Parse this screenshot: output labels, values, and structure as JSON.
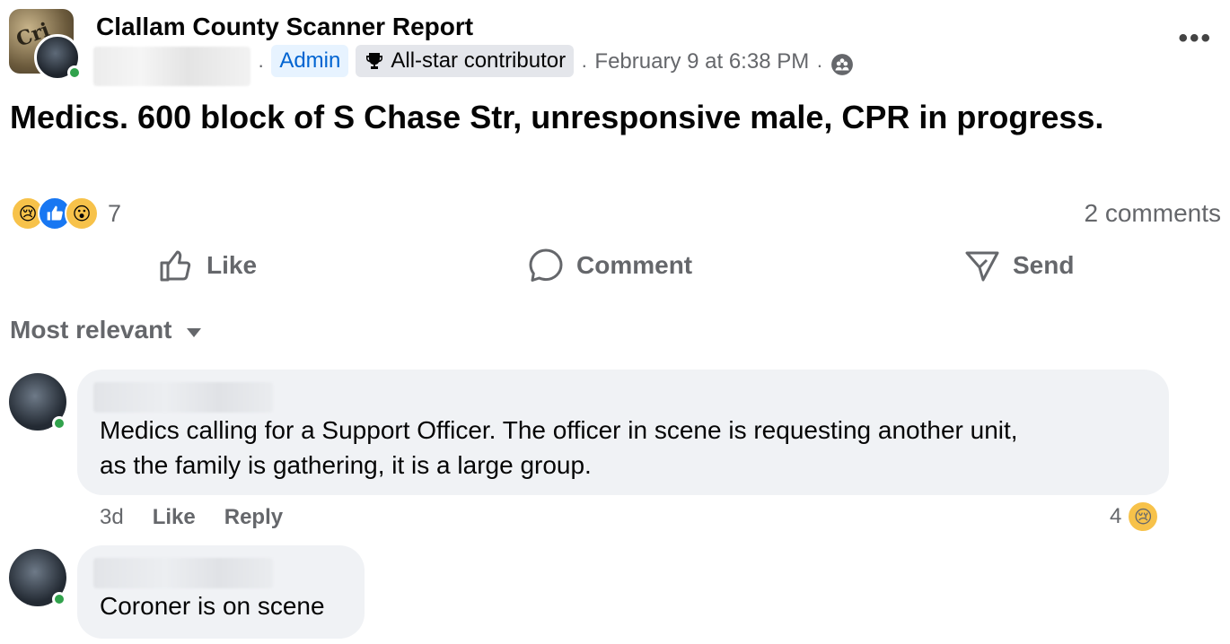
{
  "post": {
    "group_name": "Clallam County Scanner Report",
    "group_avatar_text": "Cri",
    "admin_badge": "Admin",
    "allstar_badge": "All-star contributor",
    "timestamp": "February 9 at 6:38 PM",
    "body": "Medics. 600 block of S Chase Str, unresponsive male, CPR in progress."
  },
  "reactions": {
    "count": "7",
    "comments_count": "2 comments"
  },
  "actions": {
    "like": "Like",
    "comment": "Comment",
    "send": "Send"
  },
  "sort": {
    "label": "Most relevant"
  },
  "comments": [
    {
      "text_line1": "Medics calling for a Support Officer. The officer in scene is requesting another unit,",
      "text_line2": "as the family is gathering, it is a large group.",
      "age": "3d",
      "like": "Like",
      "reply": "Reply",
      "reaction_count": "4"
    },
    {
      "text_line1": "Coroner is on scene"
    }
  ],
  "colors": {
    "admin_badge_bg": "#e7f3ff",
    "admin_text": "#0064d1",
    "online": "#31a24c",
    "bubble_bg": "#f0f2f5",
    "like_blue": "#1877f2"
  }
}
